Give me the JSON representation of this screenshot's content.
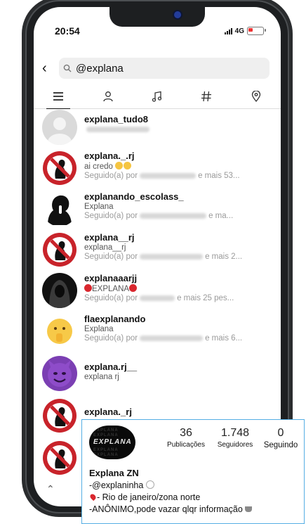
{
  "status_bar": {
    "time": "20:54",
    "network": "4G"
  },
  "search": {
    "query": "@explana"
  },
  "tabs": [
    "top-icon",
    "accounts-icon",
    "audio-icon",
    "tags-icon",
    "places-icon"
  ],
  "results": [
    {
      "username": "explana_tudo8",
      "subtitle": "",
      "followed_prefix": "",
      "followed_suffix": "",
      "avatar": "default-gray"
    },
    {
      "username": "explana._.rj",
      "subtitle": "ai credo",
      "followed_prefix": "Seguido(a) por",
      "followed_suffix": "e mais 53...",
      "avatar": "red-ring-mute"
    },
    {
      "username": "explanando_escolass_",
      "subtitle": "Explana",
      "followed_prefix": "Seguido(a) por",
      "followed_suffix": "e ma...",
      "avatar": "silhouette-shush"
    },
    {
      "username": "explana__rj",
      "subtitle": "explana__rj",
      "followed_prefix": "Seguido(a) por",
      "followed_suffix": "e mais 2...",
      "avatar": "red-ring-mute"
    },
    {
      "username": "explanaaarjj",
      "subtitle": "EXPLANA",
      "followed_prefix": "Seguido(a) por",
      "followed_suffix": "e mais 25 pes...",
      "avatar": "hooded-figure"
    },
    {
      "username": "flaexplanando",
      "subtitle": "Explana",
      "followed_prefix": "Seguido(a) por",
      "followed_suffix": "e mais 6...",
      "avatar": "shush-emoji"
    },
    {
      "username": "explana.rj__",
      "subtitle": "explana rj",
      "followed_prefix": "",
      "followed_suffix": "",
      "avatar": "purple-devil"
    },
    {
      "username": "explana._rj",
      "subtitle": "",
      "followed_prefix": "",
      "followed_suffix": "",
      "avatar": "red-ring-mute"
    }
  ],
  "profile_card": {
    "logo_text": "EXPLANA",
    "posts": "36",
    "posts_label": "Publicações",
    "followers": "1.748",
    "followers_label": "Seguidores",
    "following": "0",
    "following_label": "Seguindo",
    "name": "Explana ZN",
    "bio": [
      "-@explaninha",
      "- Rio de janeiro/zona norte",
      "-ANÔNIMO,pode vazar qlqr informação"
    ]
  },
  "colors": {
    "accent_red": "#d9272e",
    "card_border": "#55aee4",
    "mute_red": "#c8232a"
  }
}
